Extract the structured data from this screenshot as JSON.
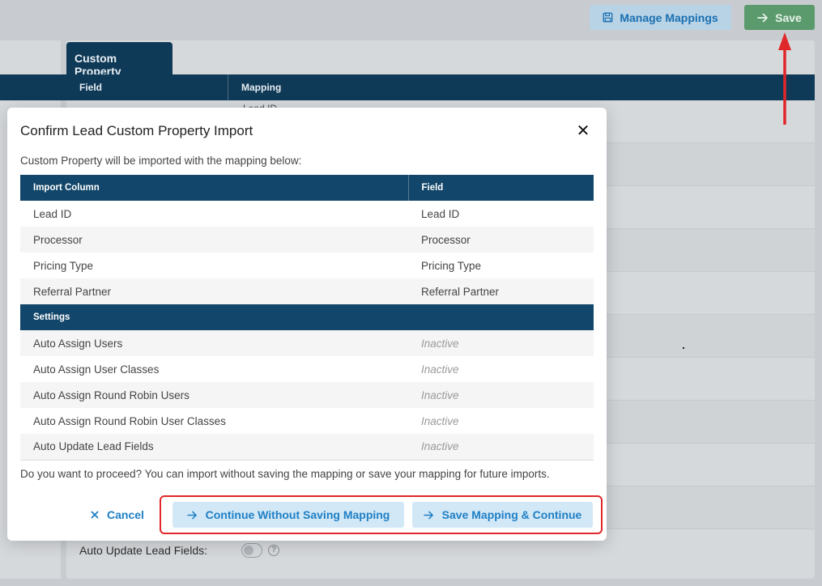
{
  "toolbar": {
    "manage_mappings_label": "Manage Mappings",
    "save_label": "Save"
  },
  "background": {
    "tab_label": "Custom Property",
    "columns": [
      "Field",
      "Mapping"
    ],
    "partial_text": "Lead ID",
    "bottom_label": "Auto Update Lead Fields:"
  },
  "modal": {
    "title": "Confirm Lead Custom Property Import",
    "intro": "Custom Property will be imported with the mapping below:",
    "table": {
      "headers": [
        "Import Column",
        "Field"
      ],
      "rows": [
        {
          "import": "Lead ID",
          "field": "Lead ID"
        },
        {
          "import": "Processor",
          "field": "Processor"
        },
        {
          "import": "Pricing Type",
          "field": "Pricing Type"
        },
        {
          "import": "Referral Partner",
          "field": "Referral Partner"
        }
      ],
      "settings_header": "Settings",
      "settings": [
        {
          "name": "Auto Assign Users",
          "value": "Inactive"
        },
        {
          "name": "Auto Assign User Classes",
          "value": "Inactive"
        },
        {
          "name": "Auto Assign Round Robin Users",
          "value": "Inactive"
        },
        {
          "name": "Auto Assign Round Robin User Classes",
          "value": "Inactive"
        },
        {
          "name": "Auto Update Lead Fields",
          "value": "Inactive"
        }
      ]
    },
    "question": "Do you want to proceed? You can import without saving the mapping or save your mapping for future imports.",
    "buttons": {
      "cancel": "Cancel",
      "continue_without_saving": "Continue Without Saving Mapping",
      "save_and_continue": "Save Mapping & Continue"
    }
  },
  "colors": {
    "header_navy": "#12466a",
    "save_green": "#5b9a6c",
    "link_blue": "#1e7fc4",
    "annotation_red": "#e0272a"
  }
}
